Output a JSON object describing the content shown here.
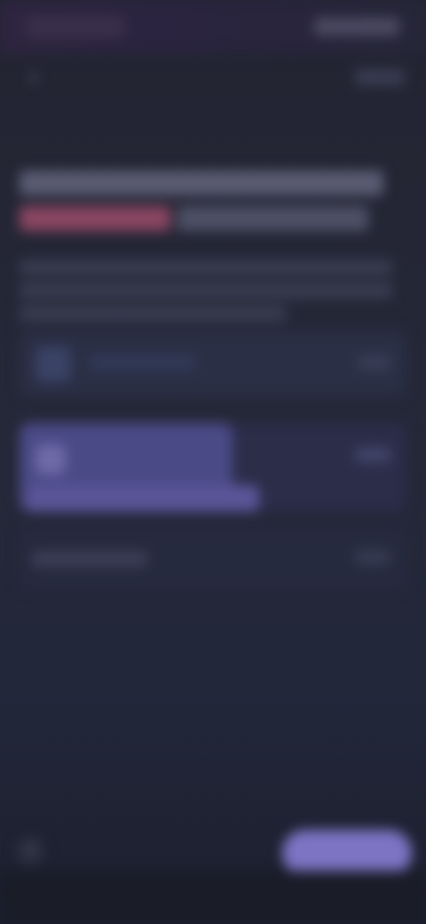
{
  "nav": {
    "back_icon": "chevron-left-icon"
  },
  "colors": {
    "background": "#242636",
    "accent": "#7d74c4",
    "highlight": "#8a4662",
    "selected": "#4a4a86"
  },
  "options": [
    {
      "state": "unselected"
    },
    {
      "state": "selected"
    },
    {
      "state": "unselected"
    }
  ],
  "footer": {
    "left_icon": "help-icon"
  }
}
